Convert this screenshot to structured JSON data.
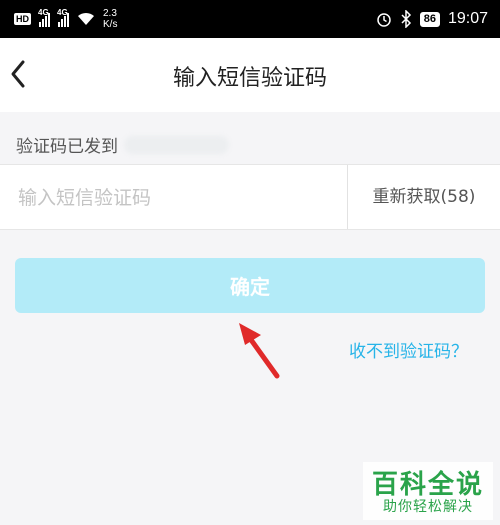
{
  "status_bar": {
    "hd": "HD",
    "net1": "4G",
    "net2": "4G",
    "speed_value": "2.3",
    "speed_unit": "K/s",
    "battery": "86",
    "time": "19:07"
  },
  "nav": {
    "title": "输入短信验证码"
  },
  "form": {
    "sent_label": "验证码已发到",
    "code_placeholder": "输入短信验证码",
    "resend_label": "重新获取(58)",
    "confirm_label": "确定",
    "no_code_link": "收不到验证码？"
  },
  "watermark": {
    "title": "百科全说",
    "subtitle": "助你轻松解决"
  },
  "colors": {
    "confirm_button": "#b3ebf8",
    "link": "#27b4e8",
    "annotation_arrow": "#e02a2a",
    "watermark": "#2aa34a"
  },
  "icons": {
    "back": "chevron-left-icon",
    "alarm": "alarm-icon",
    "bluetooth": "bluetooth-icon",
    "wifi": "wifi-icon"
  }
}
